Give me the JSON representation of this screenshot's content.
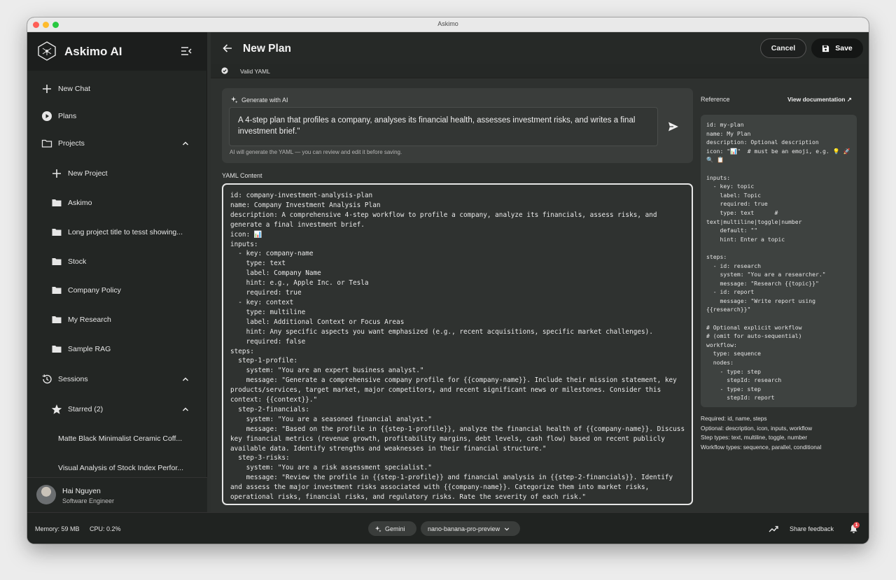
{
  "window": {
    "title": "Askimo"
  },
  "sidebar": {
    "brand": "Askimo AI",
    "new_chat": "New Chat",
    "plans": "Plans",
    "projects": "Projects",
    "project_items": [
      "New Project",
      "Askimo",
      "Long project title to tesst showing...",
      "Stock",
      "Company Policy",
      "My Research",
      "Sample RAG"
    ],
    "sessions": "Sessions",
    "starred": "Starred (2)",
    "starred_items": [
      "Matte Black Minimalist Ceramic Coff...",
      "Visual Analysis of Stock Index Perfor..."
    ],
    "user": {
      "name": "Hai Nguyen",
      "role": "Software Engineer"
    }
  },
  "header": {
    "title": "New Plan",
    "cancel": "Cancel",
    "save": "Save",
    "valid": "Valid YAML"
  },
  "generate": {
    "title": "Generate with AI",
    "prompt": "A 4-step plan that profiles a company, analyses its financial health, assesses investment risks, and writes a final investment brief.\"",
    "hint": "AI will generate the YAML — you can review and edit it before saving."
  },
  "yaml": {
    "label": "YAML Content",
    "content": "id: company-investment-analysis-plan\nname: Company Investment Analysis Plan\ndescription: A comprehensive 4-step workflow to profile a company, analyze its financials, assess risks, and generate a final investment brief.\nicon: 📊\ninputs:\n  - key: company-name\n    type: text\n    label: Company Name\n    hint: e.g., Apple Inc. or Tesla\n    required: true\n  - key: context\n    type: multiline\n    label: Additional Context or Focus Areas\n    hint: Any specific aspects you want emphasized (e.g., recent acquisitions, specific market challenges).\n    required: false\nsteps:\n  step-1-profile:\n    system: \"You are an expert business analyst.\"\n    message: \"Generate a comprehensive company profile for {{company-name}}. Include their mission statement, key products/services, target market, major competitors, and recent significant news or milestones. Consider this context: {{context}}.\"\n  step-2-financials:\n    system: \"You are a seasoned financial analyst.\"\n    message: \"Based on the profile in {{step-1-profile}}, analyze the financial health of {{company-name}}. Discuss key financial metrics (revenue growth, profitability margins, debt levels, cash flow) based on recent publicly available data. Identify strengths and weaknesses in their financial structure.\"\n  step-3-risks:\n    system: \"You are a risk assessment specialist.\"\n    message: \"Review the profile in {{step-1-profile}} and financial analysis in {{step-2-financials}}. Identify and assess the major investment risks associated with {{company-name}}. Categorize them into market risks, operational risks, financial risks, and regulatory risks. Rate the severity of each risk.\""
  },
  "reference": {
    "title": "Reference",
    "doc_link": "View documentation ↗",
    "example": "id: my-plan\nname: My Plan\ndescription: Optional description\nicon: \"📊\"  # must be an emoji, e.g. 💡 🚀 🔍 📋\n\ninputs:\n  - key: topic\n    label: Topic\n    required: true\n    type: text      # text|multiline|toggle|number\n    default: \"\"\n    hint: Enter a topic\n\nsteps:\n  - id: research\n    system: \"You are a researcher.\"\n    message: \"Research {{topic}}\"\n  - id: report\n    message: \"Write report using {{research}}\"\n\n# Optional explicit workflow\n# (omit for auto-sequential)\nworkflow:\n  type: sequence\n  nodes:\n    - type: step\n      stepId: research\n    - type: step\n      stepId: report",
    "notes": [
      "Required: id, name, steps",
      "Optional: description, icon, inputs, workflow",
      "Step types: text, multiline, toggle, number",
      "Workflow types: sequence, parallel, conditional"
    ]
  },
  "status": {
    "memory": "Memory: 59 MB",
    "cpu": "CPU: 0.2%",
    "provider": "Gemini",
    "model": "nano-banana-pro-preview",
    "feedback": "Share feedback",
    "notifications": "1"
  },
  "colors": {
    "danger": "#e5484d",
    "accent": "#f2f2f2",
    "panel": "#3a3d3b"
  }
}
